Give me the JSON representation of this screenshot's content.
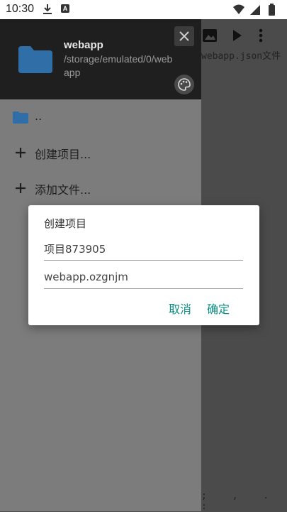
{
  "status_bar": {
    "time": "10:30",
    "icons": [
      "download-icon",
      "app-a-icon",
      "wifi-icon",
      "signal-icon",
      "battery-icon"
    ]
  },
  "editor": {
    "toolbar_icons": [
      "overflow-icon",
      "image-icon",
      "play-icon",
      "more-vert-icon"
    ],
    "tab_label": "webapp.json文件",
    "bottom_keys": ";  ,  .  :"
  },
  "drawer": {
    "header": {
      "title": "webapp",
      "path": "/storage/emulated/0/webapp"
    },
    "items": [
      {
        "icon": "folder-icon",
        "label": ".."
      },
      {
        "icon": "plus-icon",
        "label": "创建项目..."
      },
      {
        "icon": "plus-icon",
        "label": "添加文件..."
      }
    ]
  },
  "dialog": {
    "title": "创建项目",
    "name_value": "项目873905",
    "package_value": "webapp.ozgnjm",
    "cancel_label": "取消",
    "ok_label": "确定"
  },
  "colors": {
    "accent": "#0b8f84",
    "folder": "#2f6ea6",
    "drawer_header": "#1f1f1f",
    "drawer_body": "#7c7c7c"
  }
}
